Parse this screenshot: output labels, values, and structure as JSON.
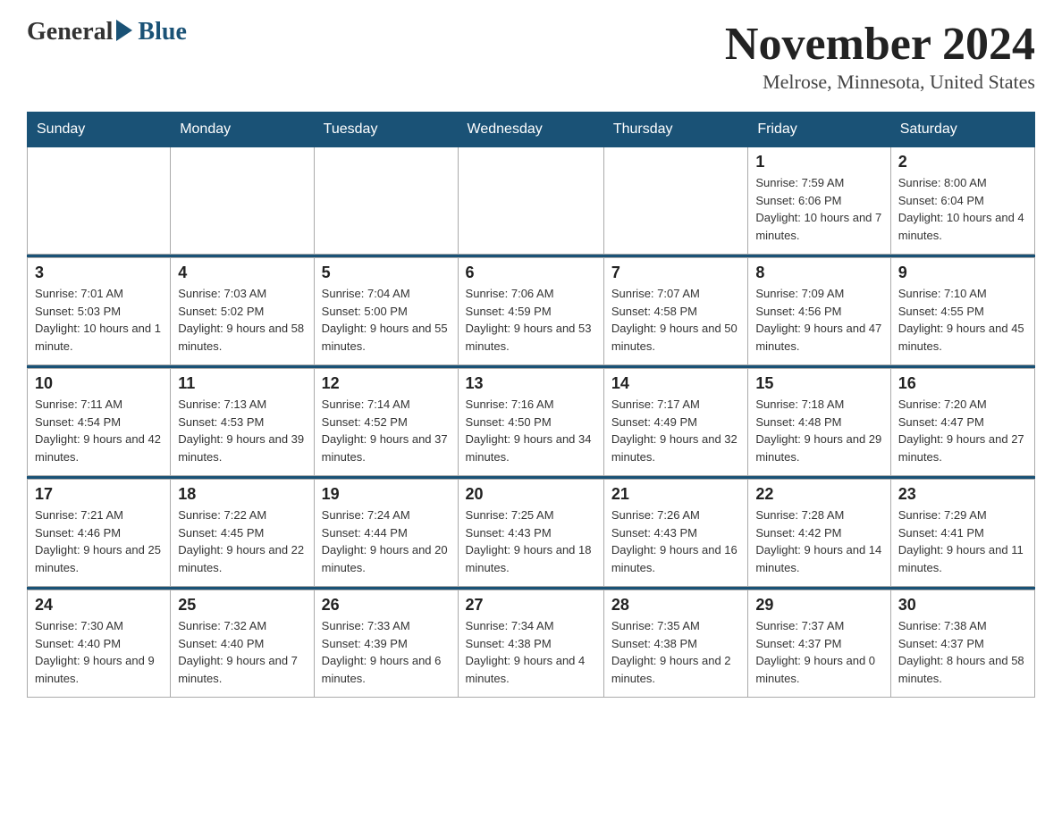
{
  "logo": {
    "general": "General",
    "blue": "Blue"
  },
  "title": "November 2024",
  "location": "Melrose, Minnesota, United States",
  "days_of_week": [
    "Sunday",
    "Monday",
    "Tuesday",
    "Wednesday",
    "Thursday",
    "Friday",
    "Saturday"
  ],
  "weeks": [
    [
      {
        "day": "",
        "info": ""
      },
      {
        "day": "",
        "info": ""
      },
      {
        "day": "",
        "info": ""
      },
      {
        "day": "",
        "info": ""
      },
      {
        "day": "",
        "info": ""
      },
      {
        "day": "1",
        "info": "Sunrise: 7:59 AM\nSunset: 6:06 PM\nDaylight: 10 hours and 7 minutes."
      },
      {
        "day": "2",
        "info": "Sunrise: 8:00 AM\nSunset: 6:04 PM\nDaylight: 10 hours and 4 minutes."
      }
    ],
    [
      {
        "day": "3",
        "info": "Sunrise: 7:01 AM\nSunset: 5:03 PM\nDaylight: 10 hours and 1 minute."
      },
      {
        "day": "4",
        "info": "Sunrise: 7:03 AM\nSunset: 5:02 PM\nDaylight: 9 hours and 58 minutes."
      },
      {
        "day": "5",
        "info": "Sunrise: 7:04 AM\nSunset: 5:00 PM\nDaylight: 9 hours and 55 minutes."
      },
      {
        "day": "6",
        "info": "Sunrise: 7:06 AM\nSunset: 4:59 PM\nDaylight: 9 hours and 53 minutes."
      },
      {
        "day": "7",
        "info": "Sunrise: 7:07 AM\nSunset: 4:58 PM\nDaylight: 9 hours and 50 minutes."
      },
      {
        "day": "8",
        "info": "Sunrise: 7:09 AM\nSunset: 4:56 PM\nDaylight: 9 hours and 47 minutes."
      },
      {
        "day": "9",
        "info": "Sunrise: 7:10 AM\nSunset: 4:55 PM\nDaylight: 9 hours and 45 minutes."
      }
    ],
    [
      {
        "day": "10",
        "info": "Sunrise: 7:11 AM\nSunset: 4:54 PM\nDaylight: 9 hours and 42 minutes."
      },
      {
        "day": "11",
        "info": "Sunrise: 7:13 AM\nSunset: 4:53 PM\nDaylight: 9 hours and 39 minutes."
      },
      {
        "day": "12",
        "info": "Sunrise: 7:14 AM\nSunset: 4:52 PM\nDaylight: 9 hours and 37 minutes."
      },
      {
        "day": "13",
        "info": "Sunrise: 7:16 AM\nSunset: 4:50 PM\nDaylight: 9 hours and 34 minutes."
      },
      {
        "day": "14",
        "info": "Sunrise: 7:17 AM\nSunset: 4:49 PM\nDaylight: 9 hours and 32 minutes."
      },
      {
        "day": "15",
        "info": "Sunrise: 7:18 AM\nSunset: 4:48 PM\nDaylight: 9 hours and 29 minutes."
      },
      {
        "day": "16",
        "info": "Sunrise: 7:20 AM\nSunset: 4:47 PM\nDaylight: 9 hours and 27 minutes."
      }
    ],
    [
      {
        "day": "17",
        "info": "Sunrise: 7:21 AM\nSunset: 4:46 PM\nDaylight: 9 hours and 25 minutes."
      },
      {
        "day": "18",
        "info": "Sunrise: 7:22 AM\nSunset: 4:45 PM\nDaylight: 9 hours and 22 minutes."
      },
      {
        "day": "19",
        "info": "Sunrise: 7:24 AM\nSunset: 4:44 PM\nDaylight: 9 hours and 20 minutes."
      },
      {
        "day": "20",
        "info": "Sunrise: 7:25 AM\nSunset: 4:43 PM\nDaylight: 9 hours and 18 minutes."
      },
      {
        "day": "21",
        "info": "Sunrise: 7:26 AM\nSunset: 4:43 PM\nDaylight: 9 hours and 16 minutes."
      },
      {
        "day": "22",
        "info": "Sunrise: 7:28 AM\nSunset: 4:42 PM\nDaylight: 9 hours and 14 minutes."
      },
      {
        "day": "23",
        "info": "Sunrise: 7:29 AM\nSunset: 4:41 PM\nDaylight: 9 hours and 11 minutes."
      }
    ],
    [
      {
        "day": "24",
        "info": "Sunrise: 7:30 AM\nSunset: 4:40 PM\nDaylight: 9 hours and 9 minutes."
      },
      {
        "day": "25",
        "info": "Sunrise: 7:32 AM\nSunset: 4:40 PM\nDaylight: 9 hours and 7 minutes."
      },
      {
        "day": "26",
        "info": "Sunrise: 7:33 AM\nSunset: 4:39 PM\nDaylight: 9 hours and 6 minutes."
      },
      {
        "day": "27",
        "info": "Sunrise: 7:34 AM\nSunset: 4:38 PM\nDaylight: 9 hours and 4 minutes."
      },
      {
        "day": "28",
        "info": "Sunrise: 7:35 AM\nSunset: 4:38 PM\nDaylight: 9 hours and 2 minutes."
      },
      {
        "day": "29",
        "info": "Sunrise: 7:37 AM\nSunset: 4:37 PM\nDaylight: 9 hours and 0 minutes."
      },
      {
        "day": "30",
        "info": "Sunrise: 7:38 AM\nSunset: 4:37 PM\nDaylight: 8 hours and 58 minutes."
      }
    ]
  ],
  "colors": {
    "header_bg": "#1a5276",
    "header_text": "#ffffff",
    "border": "#aaaaaa"
  }
}
